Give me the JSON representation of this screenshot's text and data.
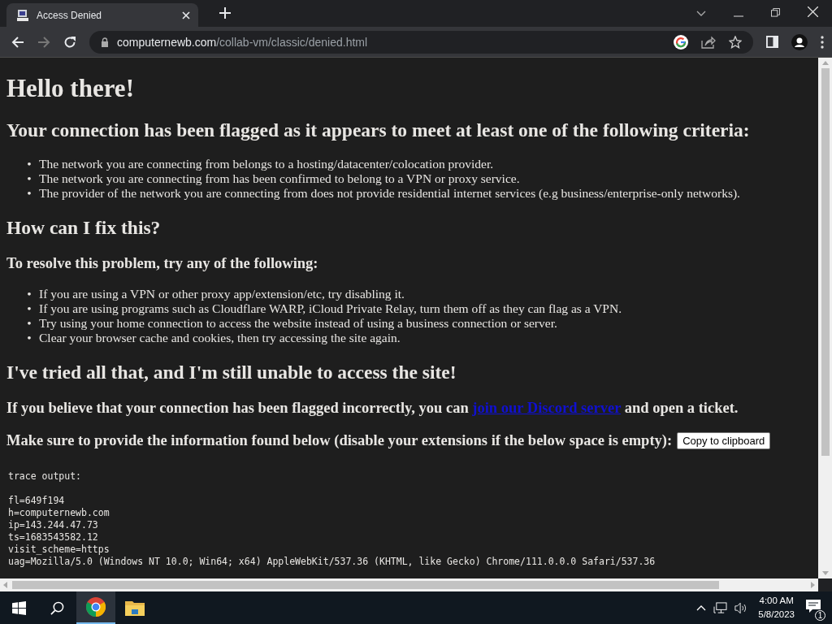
{
  "tab": {
    "title": "Access Denied",
    "selected": true
  },
  "address": {
    "domain": "computernewb.com",
    "path": "/collab-vm/classic/denied.html"
  },
  "page": {
    "title": "Hello there!",
    "criteria_heading": "Your connection has been flagged as it appears to meet at least one of the following criteria:",
    "criteria": [
      {
        "bullet": "•",
        "text": "The network you are connecting from belongs to a hosting/datacenter/colocation provider."
      },
      {
        "bullet": "•",
        "text": "The network you are connecting from has been confirmed to belong to a VPN or proxy service."
      },
      {
        "bullet": "•",
        "text": "The provider of the network you are connecting from does not provide residential internet services (e.g business/enterprise-only networks)."
      }
    ],
    "fix_heading": "How can I fix this?",
    "fix_intro": "To resolve this problem, try any of the following:",
    "fixes": [
      {
        "bullet": "•",
        "text": "If you are using a VPN or other proxy app/extension/etc, try disabling it."
      },
      {
        "bullet": "•",
        "text": "If you are using programs such as Cloudflare WARP, iCloud Private Relay, turn them off as they can flag as a VPN."
      },
      {
        "bullet": "•",
        "text": "Try using your home connection to access the website instead of using a business connection or server."
      },
      {
        "bullet": "•",
        "text": "Clear your browser cache and cookies, then try accessing the site again."
      }
    ],
    "still_heading": "I've tried all that, and I'm still unable to access the site!",
    "contact_before": "If you believe that your connection has been flagged incorrectly, you can",
    "contact_link": "join our Discord server",
    "contact_after": "and open a ticket.",
    "info_text": "Make sure to provide the information found below (disable your extensions if the below space is empty):",
    "copy_button": "Copy to clipboard",
    "trace_title": "trace output:",
    "trace_lines": [
      "fl=649f194",
      "h=computernewb.com",
      "ip=143.244.47.73",
      "ts=1683543582.12",
      "visit_scheme=https",
      "uag=Mozilla/5.0 (Windows NT 10.0; Win64; x64) AppleWebKit/537.36 (KHTML, like Gecko) Chrome/111.0.0.0 Safari/537.36"
    ]
  },
  "taskbar": {
    "time": "4:00 AM",
    "date": "5/8/2023",
    "notifications": "1"
  }
}
